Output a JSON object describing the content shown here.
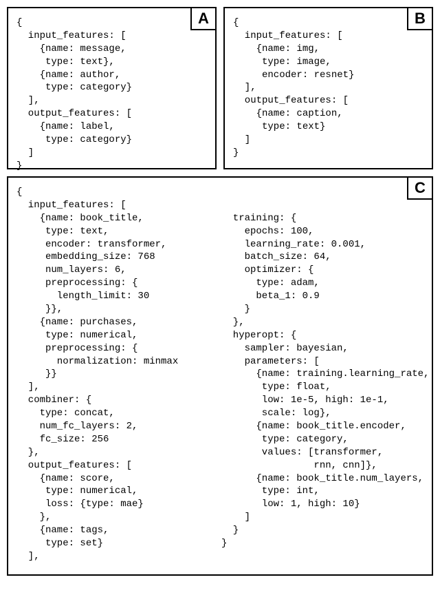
{
  "panelA": {
    "label": "A",
    "code": "{\n  input_features: [\n    {name: message,\n     type: text},\n    {name: author,\n     type: category}\n  ],\n  output_features: [\n    {name: label,\n     type: category}\n  ]\n}"
  },
  "panelB": {
    "label": "B",
    "code": "{\n  input_features: [\n    {name: img,\n     type: image,\n     encoder: resnet}\n  ],\n  output_features: [\n    {name: caption,\n     type: text}\n  ]\n}"
  },
  "panelC": {
    "label": "C",
    "left": "{\n  input_features: [\n    {name: book_title,\n     type: text,\n     encoder: transformer,\n     embedding_size: 768\n     num_layers: 6,\n     preprocessing: {\n       length_limit: 30\n     }},\n    {name: purchases,\n     type: numerical,\n     preprocessing: {\n       normalization: minmax\n     }}\n  ],\n  combiner: {\n    type: concat,\n    num_fc_layers: 2,\n    fc_size: 256\n  },\n  output_features: [\n    {name: score,\n     type: numerical,\n     loss: {type: mae}\n    },\n    {name: tags,\n     type: set}\n  ],",
    "right": "\n\n  training: {\n    epochs: 100,\n    learning_rate: 0.001,\n    batch_size: 64,\n    optimizer: {\n      type: adam,\n      beta_1: 0.9\n    }\n  },\n  hyperopt: {\n    sampler: bayesian,\n    parameters: [\n      {name: training.learning_rate,\n       type: float,\n       low: 1e-5, high: 1e-1,\n       scale: log},\n      {name: book_title.encoder,\n       type: category,\n       values: [transformer,\n                rnn, cnn]},\n      {name: book_title.num_layers,\n       type: int,\n       low: 1, high: 10}\n    ]\n  }\n}"
  }
}
